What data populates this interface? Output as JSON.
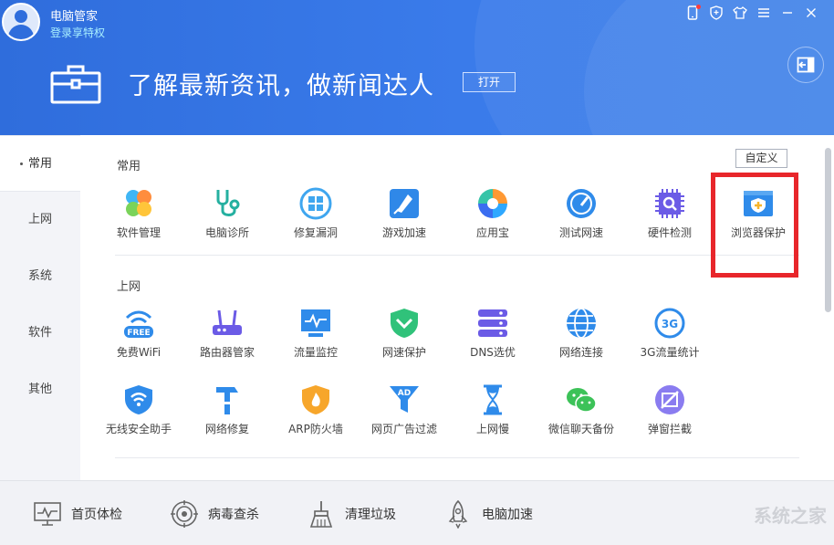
{
  "header": {
    "app_title": "电脑管家",
    "login_link": "登录享特权",
    "headline": "了解最新资讯，做新闻达人",
    "open_button": "打开"
  },
  "sidebar": {
    "items": [
      {
        "label": "常用",
        "active": true
      },
      {
        "label": "上网"
      },
      {
        "label": "系统"
      },
      {
        "label": "软件"
      },
      {
        "label": "其他"
      }
    ]
  },
  "main": {
    "custom_button": "自定义",
    "sections": [
      {
        "title": "常用",
        "tools": [
          {
            "label": "软件管理",
            "icon": "software-manager-icon"
          },
          {
            "label": "电脑诊所",
            "icon": "stethoscope-icon"
          },
          {
            "label": "修复漏洞",
            "icon": "windows-repair-icon"
          },
          {
            "label": "游戏加速",
            "icon": "game-boost-icon"
          },
          {
            "label": "应用宝",
            "icon": "app-store-icon"
          },
          {
            "label": "测试网速",
            "icon": "speedometer-icon"
          },
          {
            "label": "硬件检测",
            "icon": "chip-search-icon"
          },
          {
            "label": "浏览器保护",
            "icon": "browser-shield-icon"
          }
        ]
      },
      {
        "title": "上网",
        "tools": [
          {
            "label": "免费WiFi",
            "icon": "free-wifi-icon",
            "badge": "FREE"
          },
          {
            "label": "路由器管家",
            "icon": "router-icon"
          },
          {
            "label": "流量监控",
            "icon": "traffic-monitor-icon"
          },
          {
            "label": "网速保护",
            "icon": "shield-check-icon"
          },
          {
            "label": "DNS选优",
            "icon": "dns-server-icon"
          },
          {
            "label": "网络连接",
            "icon": "globe-icon"
          },
          {
            "label": "3G流量统计",
            "icon": "3g-icon",
            "badge": "3G"
          },
          {
            "label": "无线安全助手",
            "icon": "wifi-shield-icon"
          },
          {
            "label": "网络修复",
            "icon": "hammer-icon"
          },
          {
            "label": "ARP防火墙",
            "icon": "firewall-icon"
          },
          {
            "label": "网页广告过滤",
            "icon": "ad-filter-icon",
            "badge": "AD"
          },
          {
            "label": "上网慢",
            "icon": "hourglass-icon"
          },
          {
            "label": "微信聊天备份",
            "icon": "wechat-icon"
          },
          {
            "label": "弹窗拦截",
            "icon": "popup-block-icon"
          }
        ]
      }
    ]
  },
  "footer": {
    "items": [
      {
        "label": "首页体检",
        "icon": "monitor-pulse-icon"
      },
      {
        "label": "病毒查杀",
        "icon": "target-icon"
      },
      {
        "label": "清理垃圾",
        "icon": "broom-icon"
      },
      {
        "label": "电脑加速",
        "icon": "rocket-icon"
      }
    ],
    "watermark": "系统之家"
  },
  "colors": {
    "header_blue": "#3a7bea",
    "highlight_red": "#e8262b",
    "link_cyan": "#a9f0ff"
  }
}
